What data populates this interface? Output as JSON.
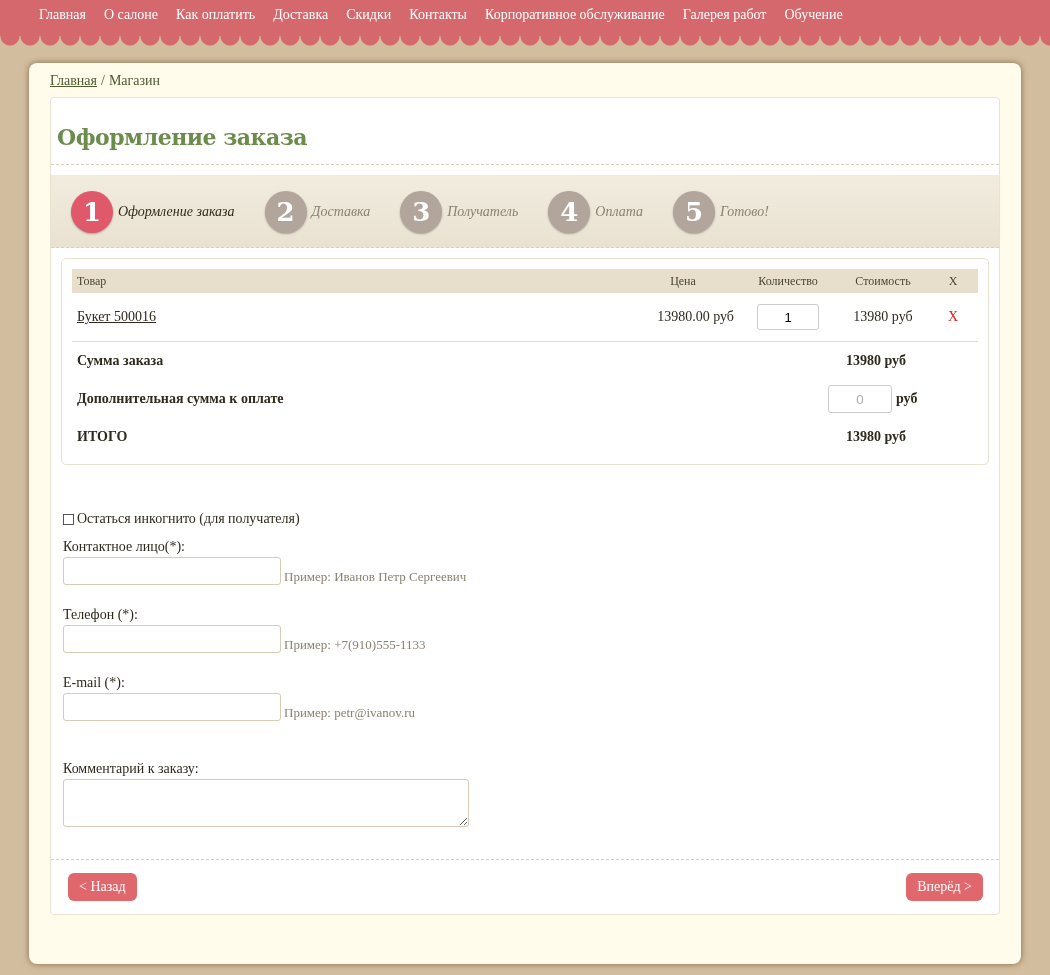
{
  "nav": {
    "items": [
      "Главная",
      "О салоне",
      "Как оплатить",
      "Доставка",
      "Скидки",
      "Контакты",
      "Корпоративное обслуживание",
      "Галерея работ",
      "Обучение"
    ]
  },
  "breadcrumb": {
    "link": "Главная",
    "separator": "/",
    "current": "Магазин"
  },
  "title": "Оформление заказа",
  "steps": [
    {
      "number": "1",
      "label": "Оформление заказа",
      "selected": true
    },
    {
      "number": "2",
      "label": "Доставка",
      "selected": false
    },
    {
      "number": "3",
      "label": "Получатель",
      "selected": false
    },
    {
      "number": "4",
      "label": "Оплата",
      "selected": false
    },
    {
      "number": "5",
      "label": "Готово!",
      "selected": false
    }
  ],
  "cart": {
    "columns": [
      "Товар",
      "Цена",
      "Количество",
      "Стоимость",
      "X"
    ],
    "rows": [
      {
        "product": "Букет 500016",
        "price": "13980.00 руб",
        "quantity": "1",
        "cost": "13980 руб",
        "remove": "X"
      }
    ],
    "subtotal": {
      "label": "Сумма заказа",
      "value": "13980 руб"
    },
    "extra": {
      "label": "Дополнительная сумма к оплате",
      "placeholder": "0",
      "unit": "руб"
    },
    "total": {
      "label": "ИТОГО",
      "value": "13980 руб"
    }
  },
  "incognito": {
    "label": "Остаться инкогнито (для получателя)",
    "checked": false
  },
  "fields": [
    {
      "label": "Контактное лицо(*):",
      "hint": "Пример: Иванов Петр Сергеевич"
    },
    {
      "label": "Телефон (*):",
      "hint": "Пример: +7(910)555-1133"
    },
    {
      "label": "E-mail (*):",
      "hint": "Пример: petr@ivanov.ru"
    }
  ],
  "comment": {
    "label": "Комментарий к заказу:"
  },
  "buttons": {
    "back": "< Назад",
    "next": "Вперёд >"
  }
}
